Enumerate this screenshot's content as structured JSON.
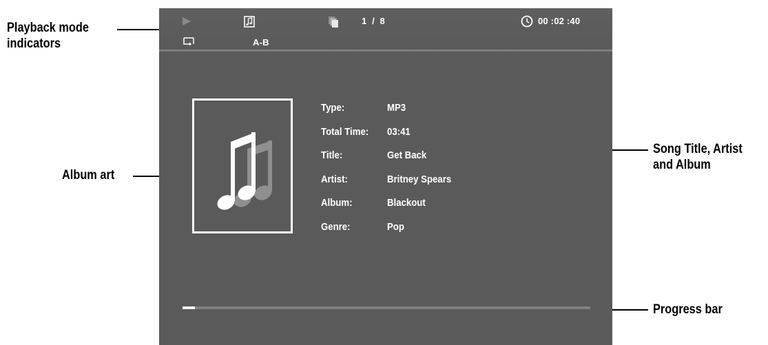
{
  "status_bar": {
    "play_icon": "play-icon",
    "music_icon": "music-note-icon",
    "folder_icon": "folder-stack-icon",
    "track_current": "1",
    "track_separator": "/",
    "track_total": "8",
    "clock_icon": "clock-icon",
    "elapsed_time": "00 :02 :40",
    "repeat_icon": "repeat-icon",
    "ab_repeat_label": "A-B"
  },
  "song_info": {
    "rows": [
      {
        "label": "Type:",
        "value": "MP3"
      },
      {
        "label": "Total Time:",
        "value": "03:41"
      },
      {
        "label": "Title:",
        "value": "Get Back"
      },
      {
        "label": "Artist:",
        "value": "Britney Spears"
      },
      {
        "label": "Album:",
        "value": "Blackout"
      },
      {
        "label": "Genre:",
        "value": "Pop"
      }
    ]
  },
  "album_art": {
    "icon": "double-music-note-icon"
  },
  "progress": {
    "fraction": 0.03
  },
  "callouts": {
    "playback_mode_line1": "Playback mode",
    "playback_mode_line2": "indicators",
    "album_art": "Album art",
    "song_info_line1": "Song Title, Artist",
    "song_info_line2": "and Album",
    "progress_bar": "Progress bar"
  },
  "colors": {
    "screen_background": "#5a5a5a",
    "text": "#ffffff",
    "progress_track": "#808080",
    "progress_fill": "#f2f2f2"
  }
}
